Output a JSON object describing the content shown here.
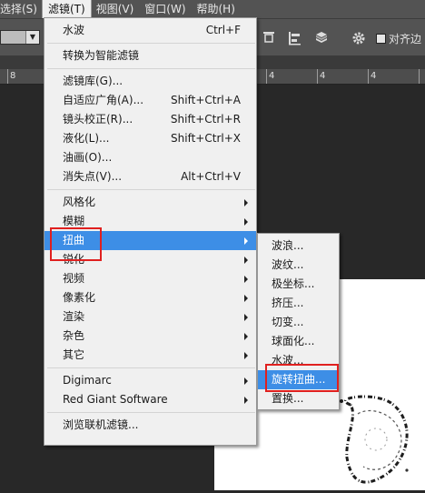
{
  "menubar": {
    "items": [
      {
        "label": "选择(S)"
      },
      {
        "label": "滤镜(T)"
      },
      {
        "label": "视图(V)"
      },
      {
        "label": "窗口(W)"
      },
      {
        "label": "帮助(H)"
      }
    ]
  },
  "options_bar": {
    "checkbox_label": "对齐边"
  },
  "ruler": {
    "labels": [
      "8",
      "4",
      "4",
      "4"
    ]
  },
  "filter_menu": {
    "last_filter": "水波",
    "last_filter_shortcut": "Ctrl+F",
    "convert_smart": "转换为智能滤镜",
    "filter_gallery": "滤镜库(G)...",
    "adaptive_wide_angle": "自适应广角(A)...",
    "adaptive_wide_angle_shortcut": "Shift+Ctrl+A",
    "lens_correction": "镜头校正(R)...",
    "lens_correction_shortcut": "Shift+Ctrl+R",
    "liquify": "液化(L)...",
    "liquify_shortcut": "Shift+Ctrl+X",
    "oil_paint": "油画(O)...",
    "vanishing_point": "消失点(V)...",
    "vanishing_point_shortcut": "Alt+Ctrl+V",
    "stylize": "风格化",
    "blur": "模糊",
    "distort": "扭曲",
    "sharpen": "锐化",
    "video": "视频",
    "pixelate": "像素化",
    "render": "渲染",
    "noise": "杂色",
    "other": "其它",
    "digimarc": "Digimarc",
    "red_giant": "Red Giant Software",
    "browse_online": "浏览联机滤镜..."
  },
  "distort_menu": {
    "items": [
      {
        "label": "波浪..."
      },
      {
        "label": "波纹..."
      },
      {
        "label": "极坐标..."
      },
      {
        "label": "挤压..."
      },
      {
        "label": "切变..."
      },
      {
        "label": "球面化..."
      },
      {
        "label": "水波..."
      },
      {
        "label": "旋转扭曲..."
      },
      {
        "label": "置换..."
      }
    ],
    "highlighted": "旋转扭曲..."
  },
  "colors": {
    "highlight": "#3d8ee6",
    "annotation": "#e0201f",
    "workspace": "#282828",
    "menu_bg": "#f0f0f0"
  }
}
